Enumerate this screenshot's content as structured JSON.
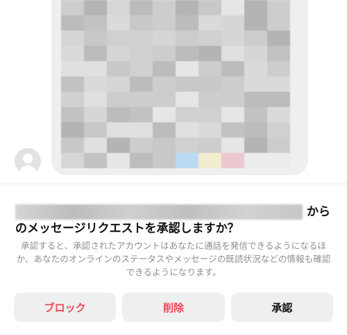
{
  "message_preview": {
    "sender_avatar": "default-profile-icon",
    "content_state": "blurred"
  },
  "request_sheet": {
    "title_suffix": "から",
    "title_line2": "のメッセージリクエストを承認しますか？",
    "description": "承認すると、承認されたアカウントはあなたに通話を発信できるようになるほか、あなたのオンラインのステータスやメッセージの既読状況などの情報も確認できるようになります。",
    "buttons": {
      "block_label": "ブロック",
      "delete_label": "削除",
      "accept_label": "承認"
    }
  },
  "colors": {
    "danger": "#ed4956",
    "button_bg": "#efefef",
    "text_primary": "#111111",
    "text_secondary": "#8e8e8e"
  }
}
